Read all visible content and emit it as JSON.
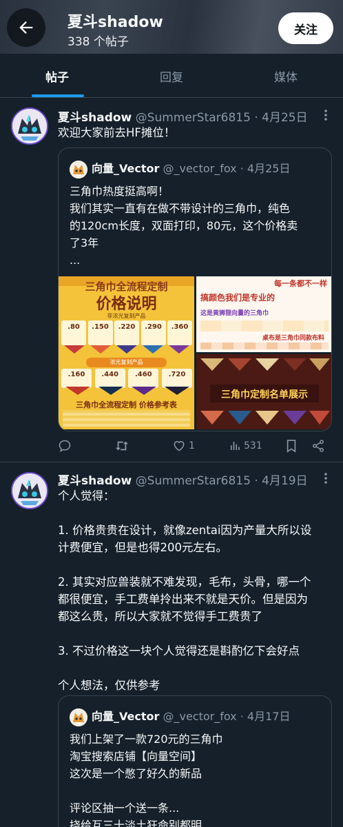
{
  "header": {
    "title": "夏斗shadow",
    "post_count": "338 个帖子",
    "follow_label": "关注"
  },
  "tabs": [
    {
      "label": "帖子",
      "active": true
    },
    {
      "label": "回复",
      "active": false
    },
    {
      "label": "媒体",
      "active": false
    }
  ],
  "posts": [
    {
      "name": "夏斗shadow",
      "handle": "@SummerStar6815",
      "date": "· 4月25日",
      "text": "欢迎大家前去HF摊位！",
      "quote": {
        "name": "向量_Vector",
        "handle": "@_vector_fox",
        "date": "· 4月25日",
        "lines": [
          "三角巾热度挺高啊！",
          "我们其实一直有在做不带设计的三角巾，纯色",
          "的120cm长度，双面打印，80元，这个价格卖",
          "了3年",
          "..."
        ],
        "images": {
          "left_title": "三角巾全流程定制",
          "left_subtitle": "价格说明",
          "left_note": "非浓光复刻产品",
          "left_prices": [
            ".80",
            ".150",
            ".220",
            ".290",
            ".360"
          ],
          "left_prices2": [
            ".160",
            ".440",
            ".460",
            ".720"
          ],
          "left_mid_label": "浓光复刻产品",
          "left_footer": "三角巾全流程定制 价格参考表",
          "tr_heading": "每一条都不一样",
          "tr_line1": "搞颜色我们是专业的",
          "tr_line2": "这是黄狮狸向量的三角巾",
          "tr_line3": "桌布是三角巾同款布料",
          "br_title": "三角巾定制名单展示"
        }
      },
      "actions": {
        "reply": "",
        "retweet": "",
        "like": "1",
        "views": "531"
      }
    },
    {
      "name": "夏斗shadow",
      "handle": "@SummerStar6815",
      "date": "· 4月19日",
      "paragraphs": [
        [
          "个人觉得："
        ],
        [
          "1. 价格贵贵在设计，就像zentai因为产量大所以设",
          "计费便宜，但是也得200元左右。"
        ],
        [
          "2. 其实对应兽装就不难发现，毛布，头骨，哪一个",
          "都很便宜，手工费单拎出来不就是天价。但是因为",
          "都这么贵，所以大家就不觉得手工费贵了"
        ],
        [
          "3. 不过价格这一块个人觉得还是斟酌亿下会好点"
        ],
        [
          "个人想法，仅供参考"
        ]
      ],
      "quote": {
        "name": "向量_Vector",
        "handle": "@_vector_fox",
        "date": "· 4月17日",
        "lines": [
          "我们上架了一款720元的三角巾",
          "淘宝搜索店铺【向量空间】",
          "这次是一个憋了好久的新品",
          "",
          "评论区抽一个送一条...",
          "挠给互三十淡土狂命别都明"
        ]
      }
    }
  ],
  "colors": {
    "background": "#15202b",
    "accent": "#1d9bf0",
    "muted": "#8b98a5",
    "border": "#38444d"
  },
  "icons": [
    "back-arrow-icon",
    "more-dots-icon",
    "reply-icon",
    "retweet-icon",
    "heart-icon",
    "views-icon",
    "bookmark-icon",
    "share-icon"
  ]
}
